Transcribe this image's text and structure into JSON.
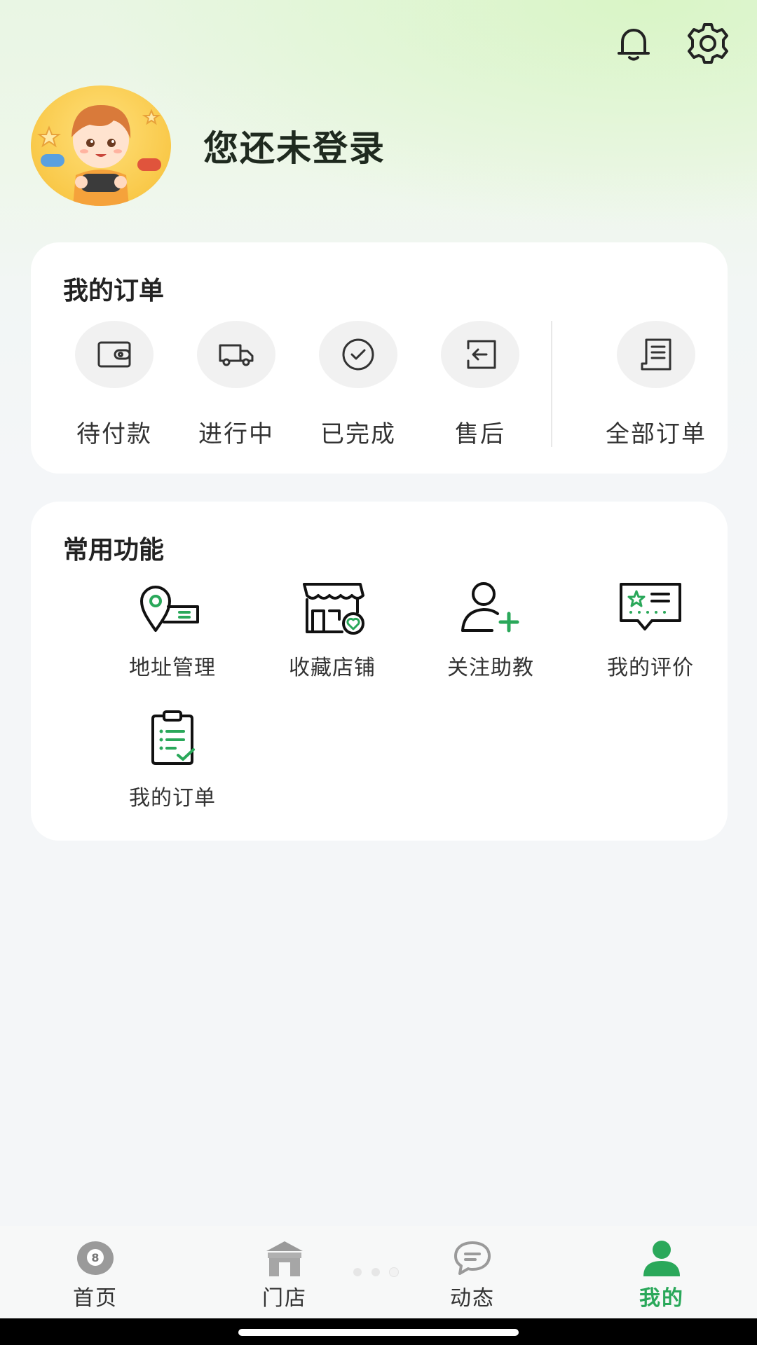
{
  "header": {
    "notification_icon": "bell-icon",
    "settings_icon": "gear-icon"
  },
  "profile": {
    "name": "您还未登录",
    "avatar_icon": "cartoon-avatar"
  },
  "orders": {
    "title": "我的订单",
    "items": [
      {
        "label": "待付款",
        "icon": "wallet-icon"
      },
      {
        "label": "进行中",
        "icon": "truck-icon"
      },
      {
        "label": "已完成",
        "icon": "check-circle-icon"
      },
      {
        "label": "售后",
        "icon": "return-icon"
      }
    ],
    "all": {
      "label": "全部订单",
      "icon": "receipt-icon"
    }
  },
  "functions": {
    "title": "常用功能",
    "items": [
      {
        "label": "地址管理",
        "icon": "location-icon"
      },
      {
        "label": "收藏店铺",
        "icon": "store-heart-icon"
      },
      {
        "label": "关注助教",
        "icon": "user-add-icon"
      },
      {
        "label": "我的评价",
        "icon": "review-icon"
      },
      {
        "label": "我的订单",
        "icon": "clipboard-icon"
      }
    ]
  },
  "tabbar": {
    "items": [
      {
        "label": "首页",
        "icon": "billiard-ball-icon"
      },
      {
        "label": "门店",
        "icon": "shop-icon"
      },
      {
        "label": "动态",
        "icon": "chat-icon"
      },
      {
        "label": "我的",
        "icon": "person-icon",
        "active": true
      }
    ]
  },
  "colors": {
    "accent": "#2aa85a",
    "background": "#f4f6f8",
    "card": "#ffffff"
  }
}
